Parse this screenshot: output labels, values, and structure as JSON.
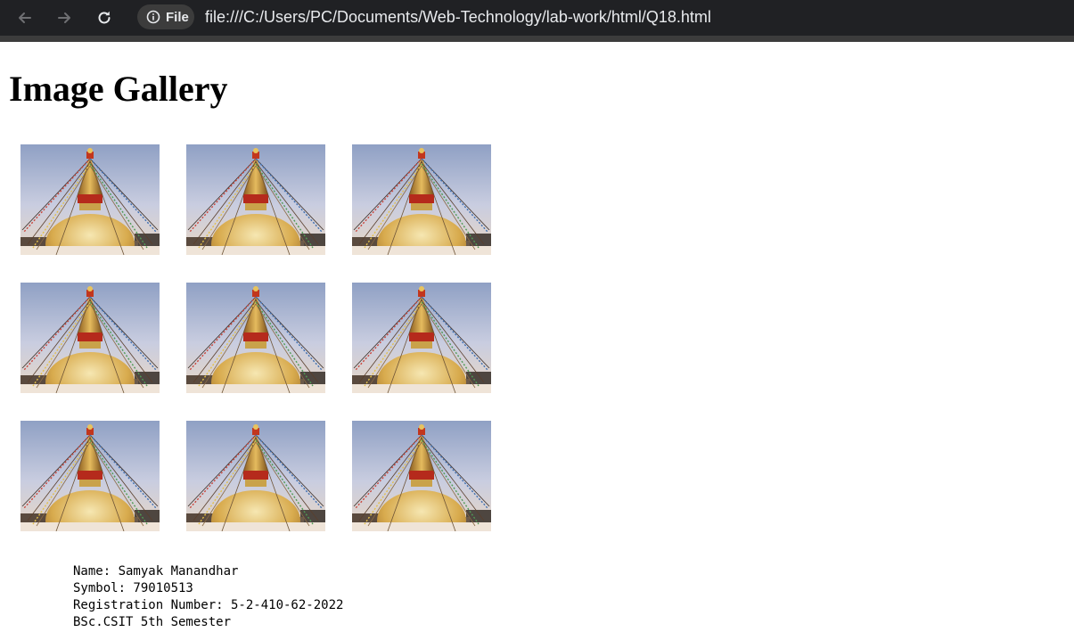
{
  "browser": {
    "back_icon": "arrow-left-icon",
    "forward_icon": "arrow-right-icon",
    "reload_icon": "reload-icon",
    "site_info_icon": "info-circle-icon",
    "site_chip_label": "File",
    "url": "file:///C:/Users/PC/Documents/Web-Technology/lab-work/html/Q18.html"
  },
  "page": {
    "title": "Image Gallery"
  },
  "gallery": {
    "columns": 3,
    "rows": 3,
    "image_count": 9
  },
  "student_info": {
    "name": "Name: Samyak Manandhar",
    "symbol": "Symbol: 79010513",
    "registration": "Registration Number: 5-2-410-62-2022",
    "program": "BSc.CSIT 5th Semester"
  }
}
